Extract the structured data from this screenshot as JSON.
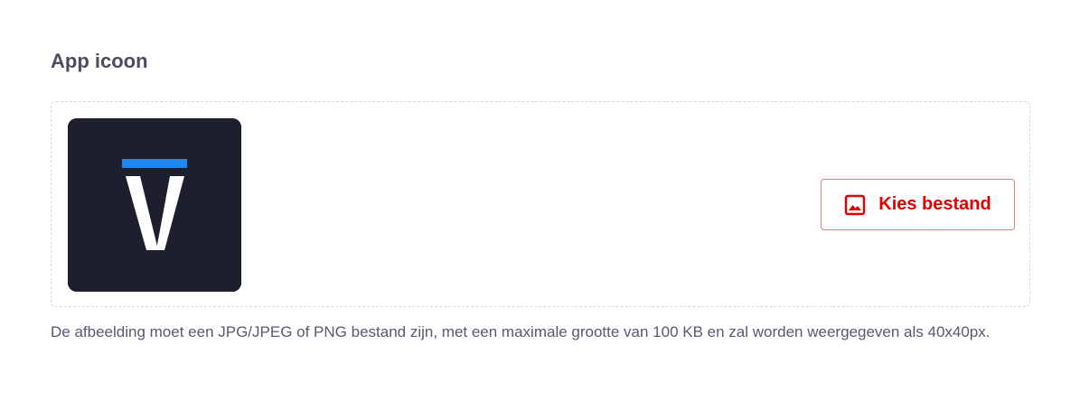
{
  "app_icon": {
    "title": "App icoon",
    "logo_name": "v-logo",
    "logo_background": "#1d1f2e",
    "logo_accent": "#1e88f0",
    "choose_button": {
      "label": "Kies bestand",
      "icon": "image-icon",
      "color": "#e00000"
    },
    "help_text": "De afbeelding moet een JPG/JPEG of PNG bestand zijn, met een maximale grootte van 100 KB en zal worden weergegeven als 40x40px."
  }
}
